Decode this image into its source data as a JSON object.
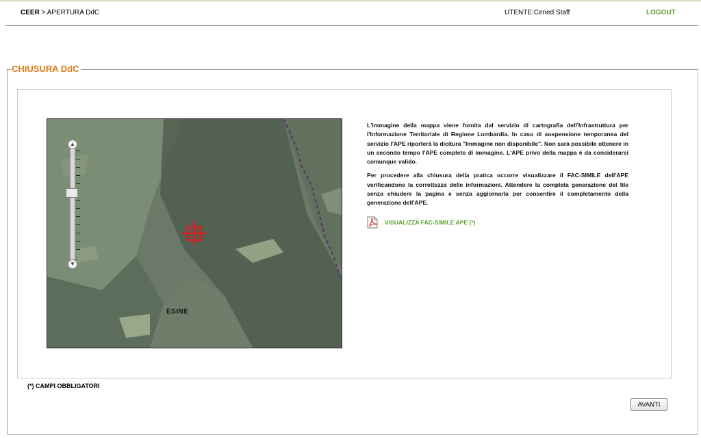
{
  "header": {
    "breadcrumb_root": "CEER",
    "breadcrumb_sep": ">",
    "breadcrumb_page": "APERTURA DdC",
    "user": "UTENTE:Cened Staff",
    "logout": "LOGOUT"
  },
  "section": {
    "title": "CHIUSURA DdC"
  },
  "map": {
    "place_label": "ESINE",
    "zoom_level_fraction": 0.43,
    "icons": [
      "zoom-in-icon",
      "zoom-out-icon",
      "target-marker-icon"
    ]
  },
  "info": {
    "paragraph1": "L'immagine della mappa viene fornita dal servizio di cartografia dell'Infrastruttura per l'Informazione Territoriale di Regione Lombardia. In caso di sospensione temporanea del servizio l'APE riporterà la dicitura \"Immagine non disponibile\". Non sarà possibile ottenere in un secondo tempo l'APE completo di immagine. L'APE privo della mappa è da considerarsi comunque valido.",
    "paragraph2": "Per procedere alla chiusura della pratica occorre visualizzare il FAC-SIMILE dell'APE verificandone la correttezza delle informazioni. Attendere la completa generazione del file senza chiudere la pagina e senza aggiornarla per consentire il completamento della generazione dell'APE.",
    "pdf_link": "VISUALIZZA FAC-SIMILE APE (*)"
  },
  "footer": {
    "required_note": "(*) CAMPI OBBLIGATORI",
    "next_button": "AVANTI"
  },
  "colors": {
    "accent_orange": "#e07b1a",
    "link_green": "#5aa02c",
    "marker_red": "#d42020"
  }
}
